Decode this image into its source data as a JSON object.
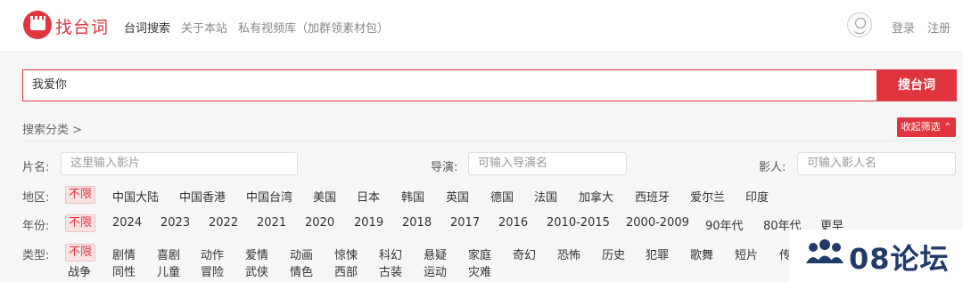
{
  "header": {
    "logo_text": "找台词",
    "nav": [
      "台词搜索",
      "关于本站",
      "私有视频库（加群领素材包）"
    ],
    "login": "登录",
    "register": "注册"
  },
  "search": {
    "value": "我爱你",
    "button": "搜台词"
  },
  "filters": {
    "category_link": "搜索分类 >",
    "collapse": "收起筛选 ⌃",
    "film": {
      "label": "片名:",
      "placeholder": "这里输入影片"
    },
    "director": {
      "label": "导演:",
      "placeholder": "可输入导演名"
    },
    "actor": {
      "label": "影人:",
      "placeholder": "可输入影人名"
    },
    "region": {
      "label": "地区:",
      "options": [
        "不限",
        "中国大陆",
        "中国香港",
        "中国台湾",
        "美国",
        "日本",
        "韩国",
        "英国",
        "德国",
        "法国",
        "加拿大",
        "西班牙",
        "爱尔兰",
        "印度"
      ]
    },
    "year": {
      "label": "年份:",
      "options": [
        "不限",
        "2024",
        "2023",
        "2022",
        "2021",
        "2020",
        "2019",
        "2018",
        "2017",
        "2016",
        "2010-2015",
        "2000-2009",
        "90年代",
        "80年代",
        "更早"
      ]
    },
    "genre": {
      "label": "类型:",
      "options": [
        "不限",
        "剧情",
        "喜剧",
        "动作",
        "爱情",
        "动画",
        "惊悚",
        "科幻",
        "悬疑",
        "家庭",
        "奇幻",
        "恐怖",
        "历史",
        "犯罪",
        "歌舞",
        "短片",
        "传",
        "战争",
        "同性",
        "儿童",
        "冒险",
        "武侠",
        "情色",
        "西部",
        "古装",
        "运动",
        "灾难"
      ]
    }
  },
  "watermark": {
    "text": "08论坛",
    "icon": "people-group-icon"
  },
  "colors": {
    "accent": "#e0353f",
    "watermark": "#1f3a6b"
  }
}
